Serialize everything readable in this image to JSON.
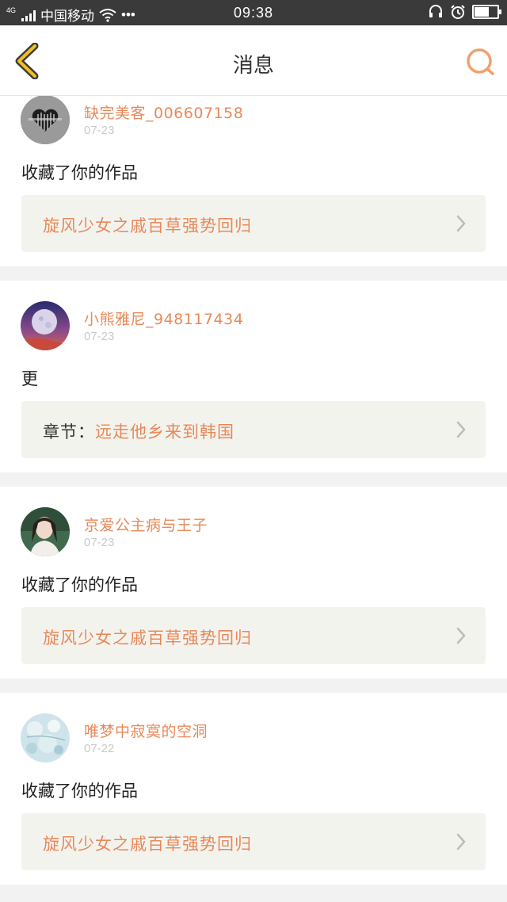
{
  "colors": {
    "accent": "#e8895a",
    "status_bar": "#3a3a3a",
    "nav_back": "#f0b400",
    "box_bg": "#f3f3ee"
  },
  "status_bar": {
    "network": "4G",
    "carrier": "中国移动",
    "dots": "•••",
    "time": "09:38",
    "battery_level": 0.6,
    "icons": [
      "signal-icon",
      "wifi-icon",
      "headset-icon",
      "alarm-icon",
      "battery-icon"
    ]
  },
  "nav": {
    "title": "消息",
    "back_icon": "chevron-left-icon",
    "search_icon": "search-icon"
  },
  "messages": [
    {
      "user": "缺完美客_006607158",
      "date": "07-23",
      "action": "收藏了你的作品",
      "prefix": "",
      "work": "旋风少女之戚百草强势回归",
      "avatar": "heart-avatar"
    },
    {
      "user": "小熊雅尼_948117434",
      "date": "07-23",
      "action": "更",
      "prefix": "章节：",
      "work": "远走他乡来到韩国",
      "avatar": "moon-avatar"
    },
    {
      "user": "京爱公主病与王子",
      "date": "07-23",
      "action": "收藏了你的作品",
      "prefix": "",
      "work": "旋风少女之戚百草强势回归",
      "avatar": "girl-avatar"
    },
    {
      "user": "唯梦中寂寞的空洞",
      "date": "07-22",
      "action": "收藏了你的作品",
      "prefix": "",
      "work": "旋风少女之戚百草强势回归",
      "avatar": "flower-avatar"
    }
  ]
}
